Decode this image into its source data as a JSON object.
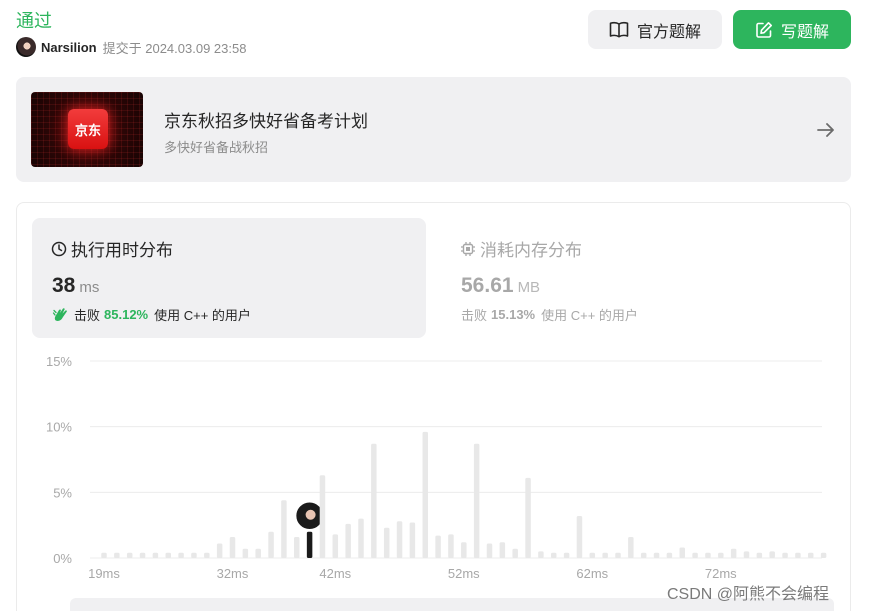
{
  "status": "通过",
  "submission": {
    "user": "Narsilion",
    "submitted_text": "提交于 2024.03.09 23:58"
  },
  "buttons": {
    "official_solution": "官方题解",
    "write_solution": "写题解"
  },
  "banner": {
    "logo_text": "京东",
    "title": "京东秋招多快好省备考计划",
    "subtitle": "多快好省备战秋招"
  },
  "runtime": {
    "title": "执行用时分布",
    "value": "38",
    "unit": "ms",
    "beat_label": "击败",
    "beat_pct": "85.12%",
    "beat_suffix": "使用 C++ 的用户"
  },
  "memory": {
    "title": "消耗内存分布",
    "value": "56.61",
    "unit": "MB",
    "beat_label": "击败",
    "beat_pct": "15.13%",
    "beat_suffix": "使用 C++ 的用户"
  },
  "watermark": "CSDN @阿熊不会编程",
  "colors": {
    "accent_green": "#2db55d",
    "bar_gray": "#e8e8e8",
    "bar_highlight": "#1a1a1a"
  },
  "chart_data": {
    "type": "bar",
    "x_unit": "ms",
    "x_tick_labels": [
      "19ms",
      "32ms",
      "42ms",
      "52ms",
      "62ms",
      "72ms"
    ],
    "y_tick_labels": [
      "15%",
      "10%",
      "5%",
      "0%"
    ],
    "ylim": [
      0,
      15
    ],
    "highlight_index": 16,
    "values": [
      0.4,
      0.4,
      0.4,
      0.4,
      0.4,
      0.4,
      0.4,
      0.4,
      0.4,
      1.1,
      1.6,
      0.7,
      0.7,
      2.0,
      4.4,
      1.6,
      2.0,
      6.3,
      1.8,
      2.6,
      3.0,
      8.7,
      2.3,
      2.8,
      2.7,
      9.6,
      1.7,
      1.8,
      1.2,
      8.7,
      1.1,
      1.2,
      0.7,
      6.1,
      0.5,
      0.4,
      0.4,
      3.2,
      0.4,
      0.4,
      0.4,
      1.6,
      0.4,
      0.4,
      0.4,
      0.8,
      0.4,
      0.4,
      0.4,
      0.7,
      0.5,
      0.4,
      0.5,
      0.4,
      0.4,
      0.4,
      0.4
    ]
  }
}
